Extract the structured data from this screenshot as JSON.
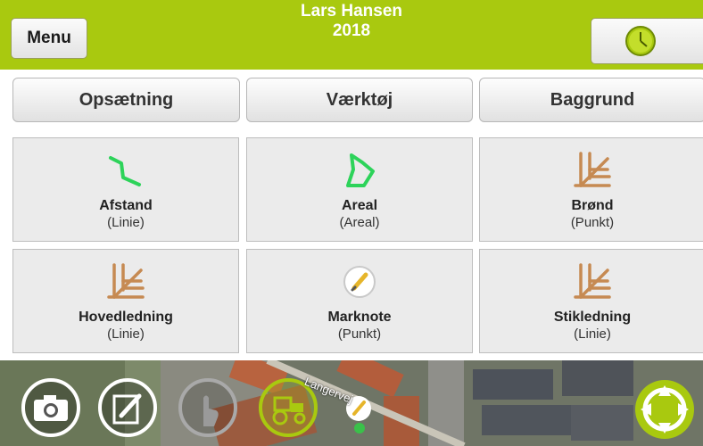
{
  "header": {
    "menu_label": "Menu",
    "user_name": "Lars Hansen",
    "year": "2018",
    "accent_color": "#a9c90f"
  },
  "tabs": [
    {
      "label": "Opsætning"
    },
    {
      "label": "Værktøj"
    },
    {
      "label": "Baggrund"
    }
  ],
  "tools": [
    {
      "name": "Afstand",
      "sub": "(Linie)",
      "icon": "line-path-icon"
    },
    {
      "name": "Areal",
      "sub": "(Areal)",
      "icon": "polygon-area-icon"
    },
    {
      "name": "Brønd",
      "sub": "(Punkt)",
      "icon": "pipeline-icon"
    },
    {
      "name": "Hovedledning",
      "sub": "(Linie)",
      "icon": "pipeline-icon"
    },
    {
      "name": "Marknote",
      "sub": "(Punkt)",
      "icon": "note-pencil-icon"
    },
    {
      "name": "Stikledning",
      "sub": "(Linie)",
      "icon": "pipeline-icon"
    }
  ],
  "map": {
    "street_label": "Langervej",
    "controls": [
      "camera-icon",
      "edit-note-icon",
      "touch-icon",
      "tractor-icon",
      "gps-target-icon"
    ]
  }
}
